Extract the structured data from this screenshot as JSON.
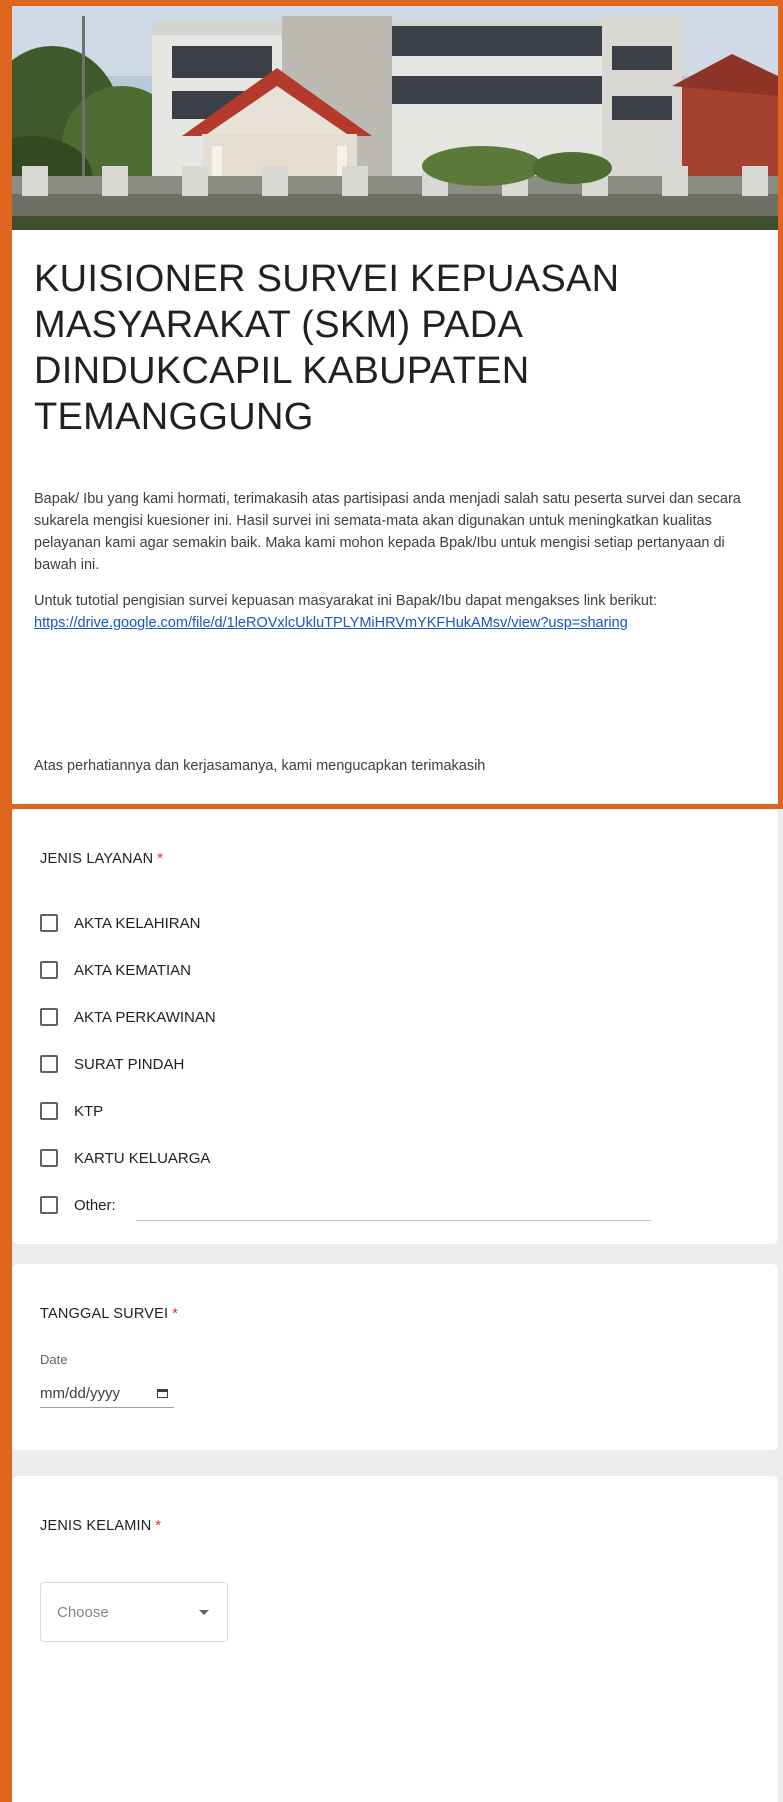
{
  "form": {
    "title": "KUISIONER SURVEI KEPUASAN MASYARAKAT (SKM) PADA DINDUKCAPIL KABUPATEN TEMANGGUNG",
    "description_p1": "Bapak/ Ibu yang kami hormati, terimakasih atas partisipasi anda menjadi salah satu peserta survei dan secara sukarela mengisi kuesioner ini. Hasil survei ini semata-mata akan digunakan untuk meningkatkan kualitas pelayanan kami agar semakin baik. Maka kami mohon kepada Bpak/Ibu untuk mengisi setiap pertanyaan di bawah ini.",
    "description_p2_prefix": "Untuk tutotial pengisian survei kepuasan masyarakat ini Bapak/Ibu dapat mengakses link berikut:",
    "tutorial_link": "https://drive.google.com/file/d/1leROVxlcUkluTPLYMiHRVmYKFHukAMsv/view?usp=sharing",
    "closing": "Atas perhatiannya dan kerjasamanya, kami mengucapkan terimakasih",
    "accent_color": "#3d4f2e",
    "frame_color": "#e0661f"
  },
  "questions": {
    "jenis_layanan": {
      "label": "JENIS LAYANAN",
      "required_mark": "*",
      "options": [
        "AKTA KELAHIRAN",
        "AKTA KEMATIAN",
        "AKTA PERKAWINAN",
        "SURAT PINDAH",
        "KTP",
        "KARTU KELUARGA",
        "Other:"
      ]
    },
    "tanggal_survei": {
      "label": "TANGGAL SURVEI",
      "required_mark": "*",
      "sublabel": "Date",
      "placeholder": "mm/dd/yyyy",
      "icon": "calendar-icon"
    },
    "jenis_kelamin": {
      "label": "JENIS KELAMIN",
      "required_mark": "*",
      "placeholder": "Choose",
      "icon": "chevron-down-icon"
    }
  }
}
